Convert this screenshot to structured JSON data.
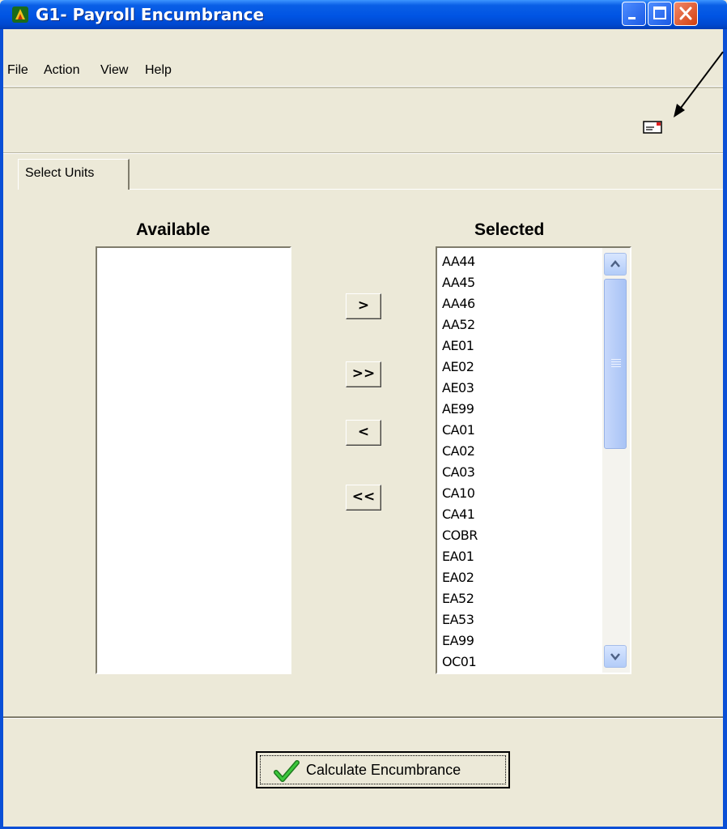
{
  "window": {
    "title": "G1- Payroll Encumbrance"
  },
  "menu": {
    "file": "File",
    "action": "Action",
    "view": "View",
    "help": "Help"
  },
  "tabs": [
    {
      "label": "Select Units"
    }
  ],
  "available": {
    "heading": "Available",
    "items": []
  },
  "selected": {
    "heading": "Selected",
    "items": [
      "AA44",
      "AA45",
      "AA46",
      "AA52",
      "AE01",
      "AE02",
      "AE03",
      "AE99",
      "CA01",
      "CA02",
      "CA03",
      "CA10",
      "CA41",
      "COBR",
      "EA01",
      "EA02",
      "EA52",
      "EA53",
      "EA99",
      "OC01"
    ]
  },
  "move_buttons": {
    "add": ">",
    "add_all": ">>",
    "remove": "<",
    "remove_all": "<<"
  },
  "calculate_button": {
    "label": "Calculate Encumbrance"
  },
  "icons": {
    "toolbar": "envelope-icon",
    "app": "app-logo-icon",
    "calc": "checkmark-icon"
  },
  "colors": {
    "titlebar": "#0054e3",
    "window_bg": "#ece9d8",
    "close": "#d3400f",
    "check": "#2ba82b"
  }
}
